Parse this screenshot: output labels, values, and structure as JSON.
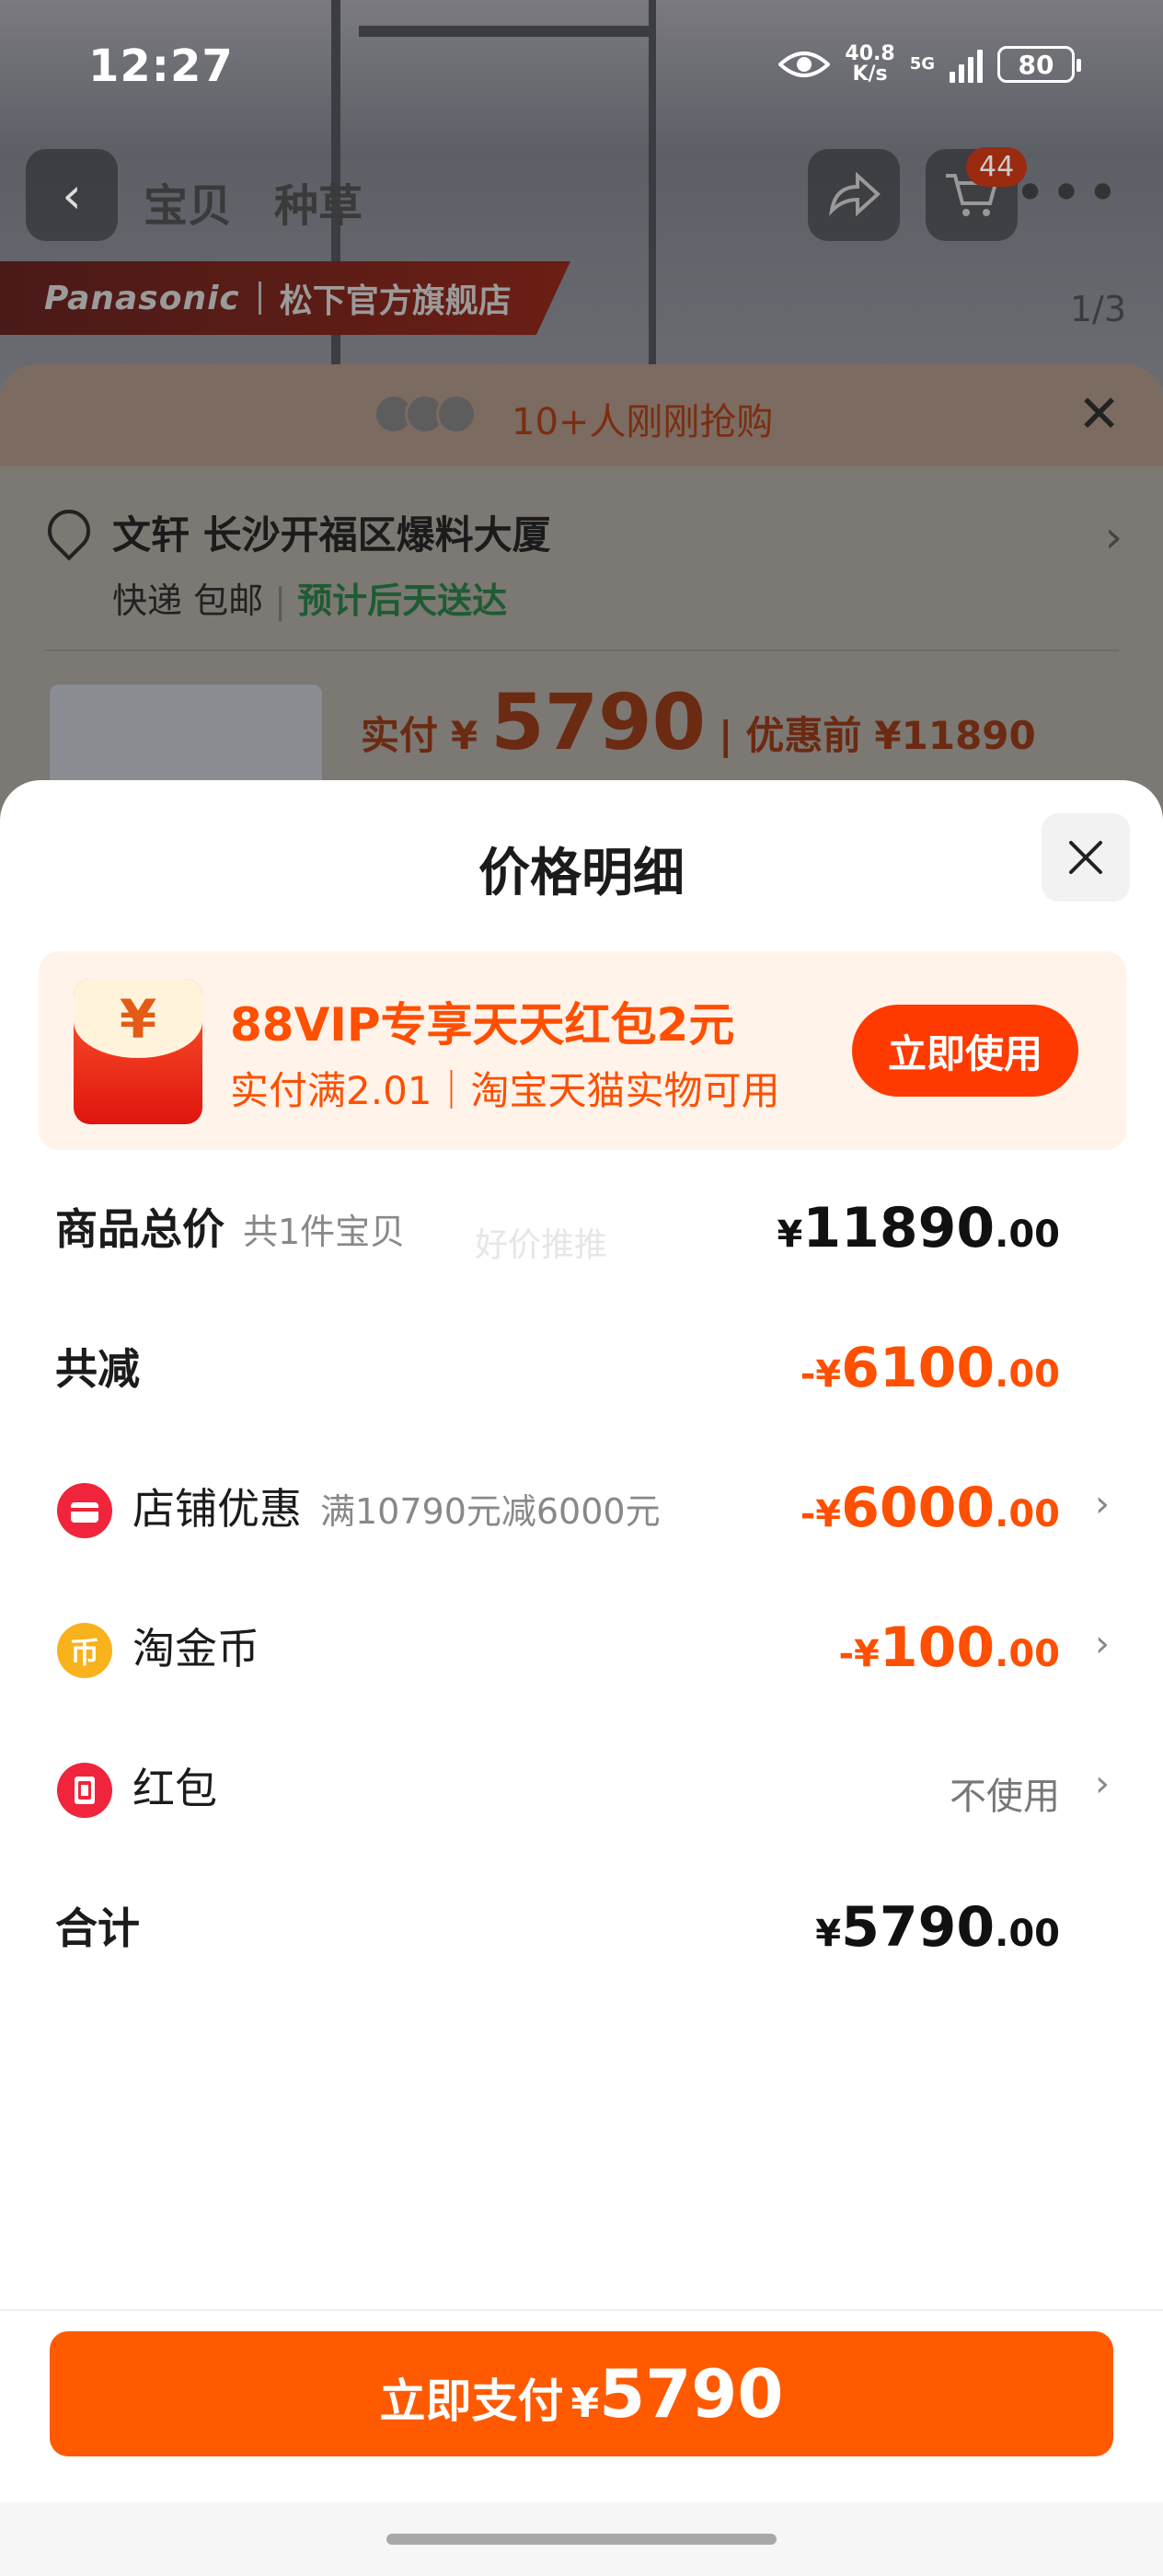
{
  "status_bar": {
    "time": "12:27",
    "net_speed_value": "40.8",
    "net_speed_unit": "K/s",
    "network": "5G",
    "battery": "80"
  },
  "nav": {
    "tab_item": "宝贝",
    "tab_recommend": "种草",
    "cart_count": "44",
    "back_icon": "chevron-left-icon",
    "share_icon": "share-icon",
    "cart_icon": "cart-icon"
  },
  "store": {
    "brand": "Panasonic",
    "name": "松下官方旗舰店",
    "page_indicator": "1/3"
  },
  "sku_sheet": {
    "buyers_text": "10+人刚刚抢购",
    "address": "文轩 长沙开福区爆料大厦",
    "shipping": "快递 包邮",
    "delivery": "预计后天送达",
    "price_label": "实付",
    "currency": "¥",
    "price": "5790",
    "original_label": "优惠前",
    "original_price": "¥11890"
  },
  "price_detail": {
    "title": "价格明细",
    "promo": {
      "title": "88VIP专享天天红包2元",
      "subtitle": "实付满2.01｜淘宝天猫实物可用",
      "button": "立即使用",
      "envelope_symbol": "¥"
    },
    "rows": {
      "total": {
        "label": "商品总价",
        "hint": "共1件宝贝",
        "currency": "¥",
        "int": "11890",
        "dec": ".00"
      },
      "discount": {
        "label": "共减",
        "currency": "-¥",
        "int": "6100",
        "dec": ".00"
      },
      "store": {
        "label": "店铺优惠",
        "hint": "满10790元减6000元",
        "currency": "-¥",
        "int": "6000",
        "dec": ".00"
      },
      "coin": {
        "label": "淘金币",
        "currency": "-¥",
        "int": "100",
        "dec": ".00",
        "icon_char": "币"
      },
      "redpacket": {
        "label": "红包",
        "value": "不使用"
      },
      "sum": {
        "label": "合计",
        "currency": "¥",
        "int": "5790",
        "dec": ".00"
      }
    },
    "watermark": "好价推推",
    "pay_button": {
      "label": "立即支付",
      "currency": "¥",
      "amount": "5790"
    }
  },
  "colors": {
    "accent": "#ff5a00",
    "promo_bg": "#fff3ea",
    "store_icon": "#f0243c",
    "coin_icon": "#f7b21c"
  }
}
